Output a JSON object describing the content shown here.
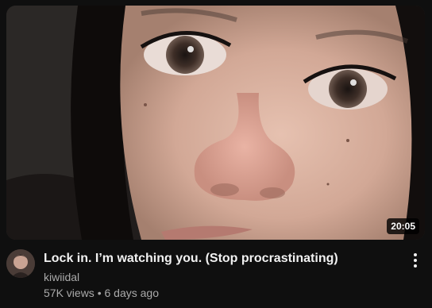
{
  "video": {
    "duration": "20:05",
    "title": "Lock in. I’m watching you. (Stop procrastinating)",
    "channel": "kiwiidal",
    "views": "57K views",
    "separator": " • ",
    "age": "6 days ago"
  },
  "icons": {
    "more": "more-vert-icon"
  },
  "colors": {
    "background": "#0f0f0f",
    "title": "#f1f1f1",
    "secondary_text": "#aaaaaa"
  }
}
